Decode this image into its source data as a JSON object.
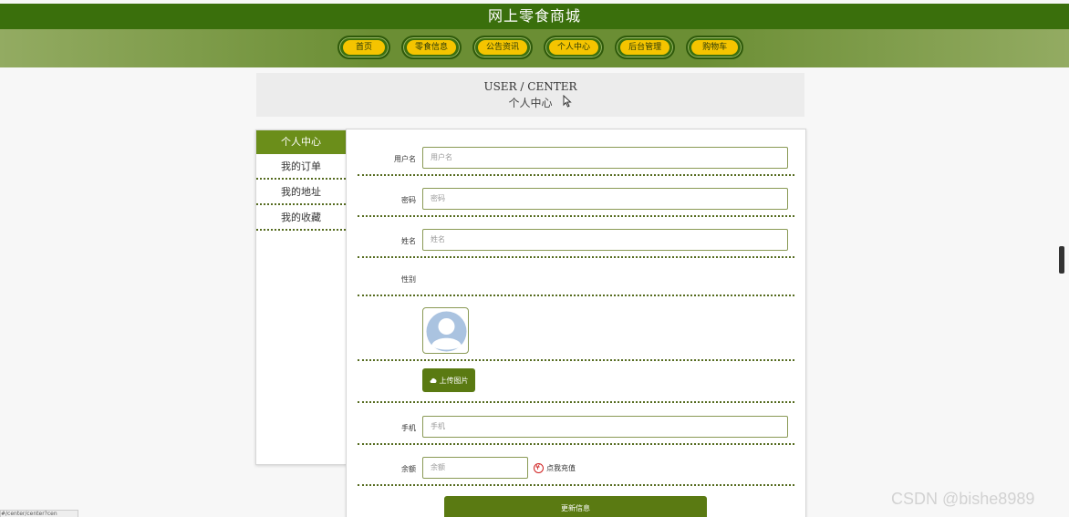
{
  "header": {
    "title": "网上零食商城"
  },
  "nav": {
    "items": [
      {
        "label": "首页"
      },
      {
        "label": "零食信息"
      },
      {
        "label": "公告资讯"
      },
      {
        "label": "个人中心"
      },
      {
        "label": "后台管理"
      },
      {
        "label": "购物车"
      }
    ]
  },
  "section": {
    "title_en": "USER / CENTER",
    "title_cn": "个人中心"
  },
  "sidebar": {
    "items": [
      {
        "label": "个人中心",
        "active": true
      },
      {
        "label": "我的订单"
      },
      {
        "label": "我的地址"
      },
      {
        "label": "我的收藏"
      }
    ]
  },
  "form": {
    "username": {
      "label": "用户名",
      "placeholder": "用户名"
    },
    "password": {
      "label": "密码",
      "placeholder": "密码"
    },
    "name": {
      "label": "姓名",
      "placeholder": "姓名"
    },
    "gender": {
      "label": "性别"
    },
    "upload": {
      "label": "上传图片"
    },
    "phone": {
      "label": "手机",
      "placeholder": "手机"
    },
    "balance": {
      "label": "余额",
      "placeholder": "余额",
      "recharge": "点我充值"
    },
    "submit": {
      "label": "更新信息"
    }
  },
  "watermark": "CSDN @bishe8989",
  "status_url": "#/center/center?cen",
  "colors": {
    "primary": "#5a7a12",
    "header": "#3a6f0c",
    "nav_pill": "#f5c400"
  }
}
